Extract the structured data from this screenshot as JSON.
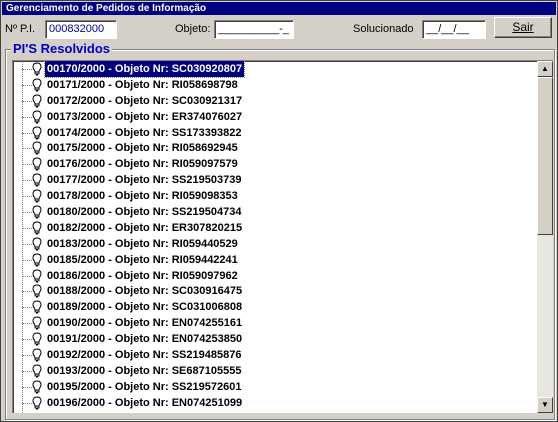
{
  "window": {
    "title": "Gerenciamento de Pedidos de Informação"
  },
  "form": {
    "pi_label": "Nº P.I.",
    "pi_value": "000832000",
    "objeto_label": "Objeto:",
    "objeto_value": "__________-_",
    "solucionado_label": "Solucionado",
    "solucionado_value": "__/__/__",
    "sair_label": "Sair"
  },
  "group": {
    "title": "PI'S Resolvidos"
  },
  "items": [
    "00170/2000 - Objeto Nr: SC030920807",
    "00171/2000 - Objeto Nr: RI058698798",
    "00172/2000 - Objeto Nr: SC030921317",
    "00173/2000 - Objeto Nr: ER374076027",
    "00174/2000 - Objeto Nr: SS173393822",
    "00175/2000 - Objeto Nr: RI058692945",
    "00176/2000 - Objeto Nr: RI059097579",
    "00177/2000 - Objeto Nr: SS219503739",
    "00178/2000 - Objeto Nr: RI059098353",
    "00180/2000 - Objeto Nr: SS219504734",
    "00182/2000 - Objeto Nr: ER307820215",
    "00183/2000 - Objeto Nr: RI059440529",
    "00185/2000 - Objeto Nr: RI059442241",
    "00186/2000 - Objeto Nr: RI059097962",
    "00188/2000 - Objeto Nr: SC030916475",
    "00189/2000 - Objeto Nr: SC031006808",
    "00190/2000 - Objeto Nr: EN074255161",
    "00191/2000 - Objeto Nr: EN074253850",
    "00192/2000 - Objeto Nr: SS219485876",
    "00193/2000 - Objeto Nr: SE687105555",
    "00195/2000 - Objeto Nr: SS219572601",
    "00196/2000 - Objeto Nr: EN074251099"
  ],
  "selected_index": 0,
  "icons": {
    "item": "lightbulb-icon",
    "scroll_up": "arrow-up-icon",
    "scroll_down": "arrow-down-icon"
  }
}
